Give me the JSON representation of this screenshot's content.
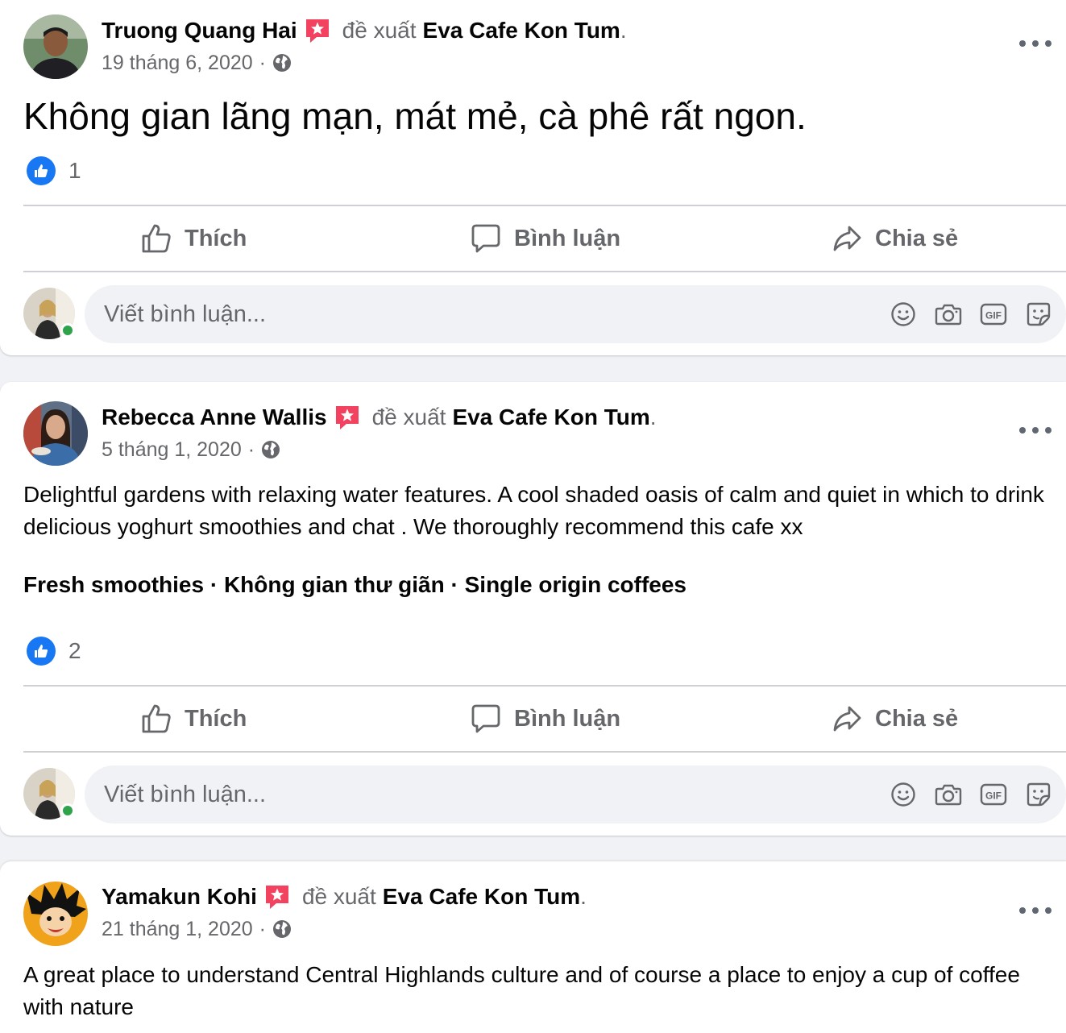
{
  "posts": [
    {
      "author": "Truong Quang Hai",
      "recommends": "đề xuất",
      "page": "Eva Cafe Kon Tum",
      "period": ".",
      "date": "19 tháng 6, 2020",
      "date_sep": "·",
      "text": "Không gian lãng mạn, mát mẻ, cà phê rất ngon.",
      "like_count": "1"
    },
    {
      "author": "Rebecca Anne Wallis",
      "recommends": "đề xuất",
      "page": "Eva Cafe Kon Tum",
      "period": ".",
      "date": "5 tháng 1, 2020",
      "date_sep": "·",
      "text": "Delightful gardens with relaxing water features. A cool shaded oasis of calm and quiet in which to drink delicious yoghurt smoothies and chat . We thoroughly recommend this cafe xx",
      "tags": "Fresh smoothies · Không gian thư giãn · Single origin coffees",
      "like_count": "2"
    },
    {
      "author": "Yamakun Kohi",
      "recommends": "đề xuất",
      "page": "Eva Cafe Kon Tum",
      "period": ".",
      "date": "21 tháng 1, 2020",
      "date_sep": "·",
      "text": "A great place to understand Central Highlands culture and of course a place to enjoy a cup of coffee with nature"
    }
  ],
  "actions": {
    "like": "Thích",
    "comment": "Bình luận",
    "share": "Chia sẻ"
  },
  "comment_box": {
    "placeholder": "Viết bình luận...",
    "icons": [
      "smiley-icon",
      "camera-icon",
      "gif-icon",
      "sticker-icon"
    ]
  },
  "icons": {
    "recommend_badge": "recommend-star-icon",
    "privacy": "globe-icon",
    "more": "more-options-icon",
    "reaction": "like-reaction-icon"
  },
  "colors": {
    "badge": "#f3425f",
    "reaction": "#1877f2",
    "secondary_text": "#65676b",
    "online": "#31a24c"
  }
}
